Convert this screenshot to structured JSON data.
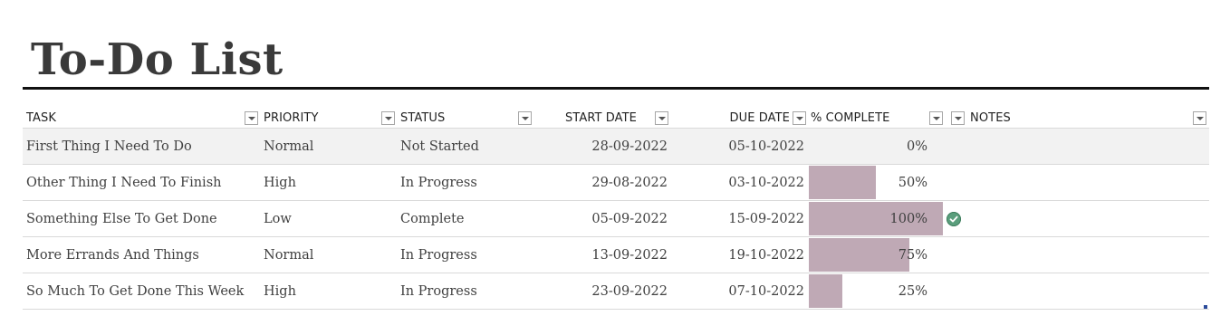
{
  "title": "To-Do List",
  "columns": {
    "task": "TASK",
    "priority": "PRIORITY",
    "status": "STATUS",
    "start_date": "START DATE",
    "due_date": "DUE DATE",
    "percent_complete": "% COMPLETE",
    "notes": "NOTES"
  },
  "rows": [
    {
      "task": "First Thing I Need To Do",
      "priority": "Normal",
      "status": "Not Started",
      "start_date": "28-09-2022",
      "due_date": "05-10-2022",
      "percent": "0%",
      "percent_value": 0,
      "done_icon": false
    },
    {
      "task": "Other Thing I Need To Finish",
      "priority": "High",
      "status": "In Progress",
      "start_date": "29-08-2022",
      "due_date": "03-10-2022",
      "percent": "50%",
      "percent_value": 0.5,
      "done_icon": false
    },
    {
      "task": "Something Else To Get Done",
      "priority": "Low",
      "status": "Complete",
      "start_date": "05-09-2022",
      "due_date": "15-09-2022",
      "percent": "100%",
      "percent_value": 1.0,
      "done_icon": true
    },
    {
      "task": "More Errands And Things",
      "priority": "Normal",
      "status": "In Progress",
      "start_date": "13-09-2022",
      "due_date": "19-10-2022",
      "percent": "75%",
      "percent_value": 0.75,
      "done_icon": false
    },
    {
      "task": "So Much To Get Done This Week",
      "priority": "High",
      "status": "In Progress",
      "start_date": "23-09-2022",
      "due_date": "07-10-2022",
      "percent": "25%",
      "percent_value": 0.25,
      "done_icon": false
    }
  ],
  "colors": {
    "bar": "#bfa9b5",
    "check": "#5a9e7c",
    "header_rule": "#111111"
  },
  "icons": {
    "filter": "chevron-down-icon",
    "complete": "check-circle-icon"
  }
}
